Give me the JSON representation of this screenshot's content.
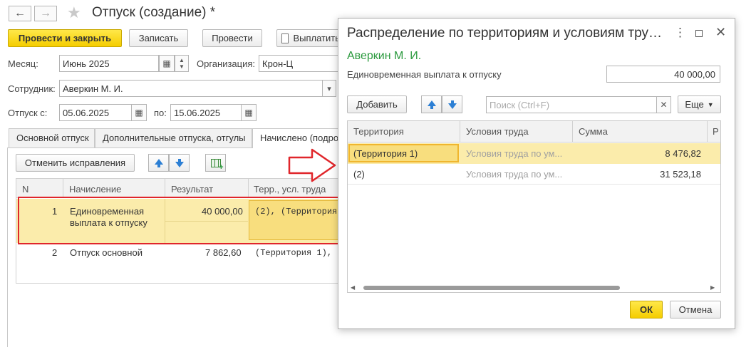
{
  "window": {
    "title": "Отпуск (создание) *"
  },
  "toolbar": {
    "post_close": "Провести и закрыть",
    "save": "Записать",
    "post": "Провести",
    "pay": "Выплатить"
  },
  "form": {
    "month_label": "Месяц:",
    "month_value": "Июнь 2025",
    "org_label": "Организация:",
    "org_value": "Крон-Ц",
    "employee_label": "Сотрудник:",
    "employee_value": "Аверкин М. И.",
    "vacation_from_label": "Отпуск с:",
    "vacation_from_value": "05.06.2025",
    "vacation_to_label": "по:",
    "vacation_to_value": "15.06.2025"
  },
  "tabs": [
    {
      "label": "Основной отпуск"
    },
    {
      "label": "Дополнительные отпуска, отгулы"
    },
    {
      "label": "Начислено (подро"
    }
  ],
  "tab_toolbar": {
    "cancel_corrections": "Отменить исправления"
  },
  "table": {
    "headers": {
      "n": "N",
      "accrual": "Начисление",
      "result": "Результат",
      "territory": "Терр., усл. труда"
    },
    "rows": [
      {
        "n": "1",
        "accrual_line1": "Единовременная",
        "accrual_line2": "выплата к отпуску",
        "result": "40 000,00",
        "territory": "(2), (Территория"
      },
      {
        "n": "2",
        "accrual_line1": "Отпуск основной",
        "accrual_line2": "",
        "result": "7 862,60",
        "territory": "(Территория 1), ("
      }
    ]
  },
  "dialog": {
    "title": "Распределение по территориям и условиям тру…",
    "employee": "Аверкин М. И.",
    "payment_label": "Единовременная выплата к отпуску",
    "payment_value": "40 000,00",
    "add_button": "Добавить",
    "search_placeholder": "Поиск (Ctrl+F)",
    "more_button": "Еще",
    "headers": {
      "territory": "Территория",
      "conditions": "Условия труда",
      "sum": "Сумма",
      "extra": "Р"
    },
    "rows": [
      {
        "territory": "(Территория 1)",
        "conditions": "Условия труда по ум...",
        "sum": "8 476,82"
      },
      {
        "territory": "(2)",
        "conditions": "Условия труда по ум...",
        "sum": "31 523,18"
      }
    ],
    "ok": "ОК",
    "cancel": "Отмена"
  },
  "colors": {
    "accent_yellow": "#f5cd00",
    "selection": "#fbecab",
    "highlight_red": "#e0262b",
    "green_name": "#2b9a3e",
    "arrow_blue": "#2c7fd4"
  }
}
